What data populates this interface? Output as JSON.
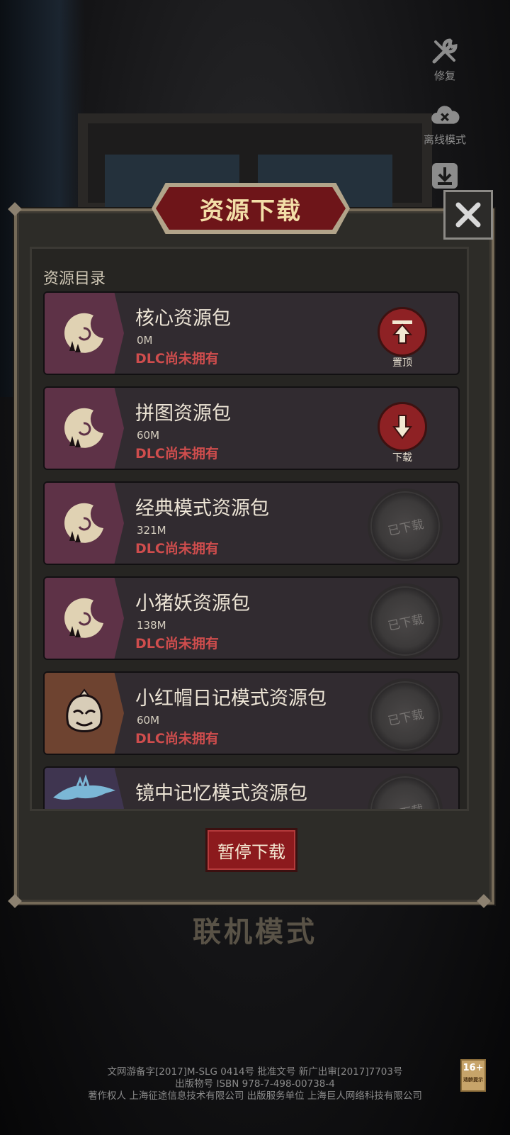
{
  "side_menu": {
    "repair_label": "修复",
    "offline_label": "离线模式"
  },
  "background_title": "联机模式",
  "dialog": {
    "title": "资源下载",
    "section_label": "资源目录",
    "pause_label": "暂停下载"
  },
  "items": [
    {
      "name": "核心资源包",
      "size": "0M",
      "status": "DLC尚未拥有",
      "action": "置顶",
      "action_icon": "pin-top-icon",
      "thumb_color": "#5e3247"
    },
    {
      "name": "拼图资源包",
      "size": "60M",
      "status": "DLC尚未拥有",
      "action": "下载",
      "action_icon": "download-icon",
      "thumb_color": "#5e3247"
    },
    {
      "name": "经典模式资源包",
      "size": "321M",
      "status": "DLC尚未拥有",
      "action": "已下载",
      "action_icon": "downloaded-stamp-icon",
      "thumb_color": "#5e3247"
    },
    {
      "name": "小猪妖资源包",
      "size": "138M",
      "status": "DLC尚未拥有",
      "action": "已下载",
      "action_icon": "downloaded-stamp-icon",
      "thumb_color": "#5e3247"
    },
    {
      "name": "小红帽日记模式资源包",
      "size": "60M",
      "status": "DLC尚未拥有",
      "action": "已下载",
      "action_icon": "downloaded-stamp-icon",
      "thumb_color": "#6e4330"
    },
    {
      "name": "镜中记忆模式资源包",
      "action": "已下载",
      "action_icon": "downloaded-stamp-icon",
      "thumb_color": "#3f3550"
    }
  ],
  "footer": {
    "line1": "文网游备字[2017]M-SLG 0414号 批准文号 新广出审[2017]7703号",
    "line2": "出版物号 ISBN 978-7-498-00738-4",
    "line3": "著作权人 上海征途信息技术有限公司    出版服务单位 上海巨人网络科技有限公司",
    "age_rating": "16+",
    "age_caption": "适龄提示"
  },
  "colors": {
    "accent_red": "#8e2124",
    "title_gold": "#f3dfa8",
    "status_red": "#cf4d4d"
  }
}
